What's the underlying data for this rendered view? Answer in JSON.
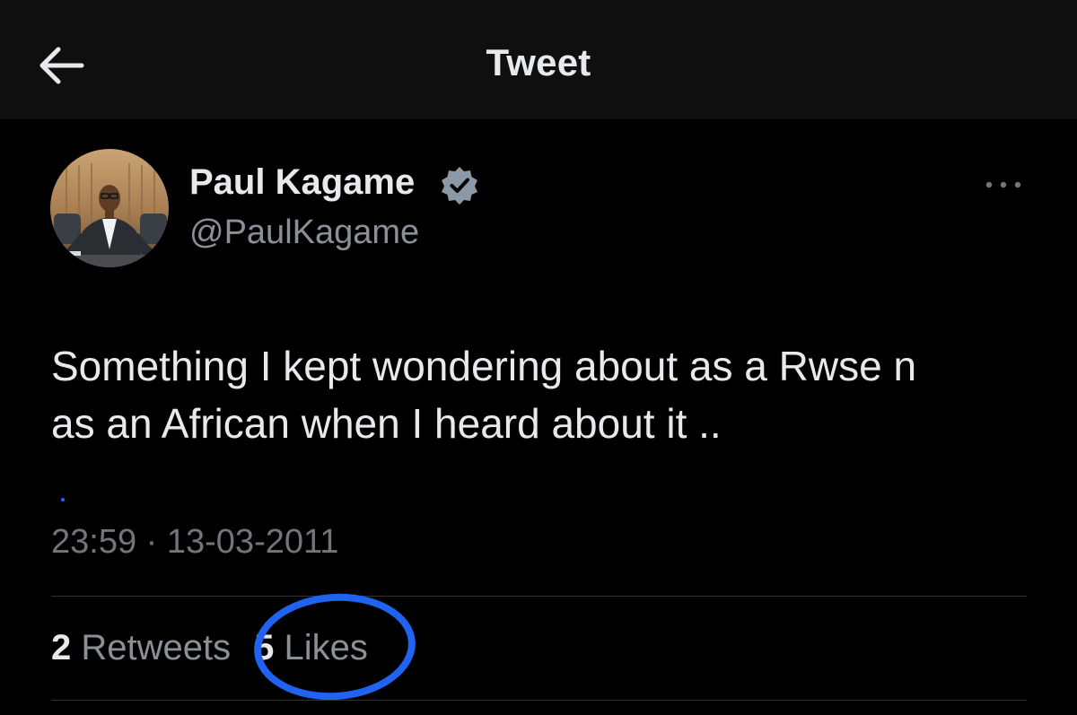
{
  "header": {
    "title": "Tweet",
    "back_icon": "arrow-left-icon"
  },
  "tweet": {
    "author_name": "Paul Kagame",
    "verified_icon": "verified-badge-icon",
    "verified_color": "#8b98a5",
    "handle": "@PaulKagame",
    "more_icon": "more-horizontal-icon",
    "text_line1": "Something I kept wondering about as a Rwse n",
    "text_line2": "as an African when I heard about it ..",
    "time": "23:59",
    "separator": "·",
    "date": "13-03-2011",
    "retweets": {
      "count": "2",
      "label": "Retweets"
    },
    "likes": {
      "count": "5",
      "label": "Likes"
    }
  },
  "annotation": {
    "circle_color": "#1f63f0"
  }
}
